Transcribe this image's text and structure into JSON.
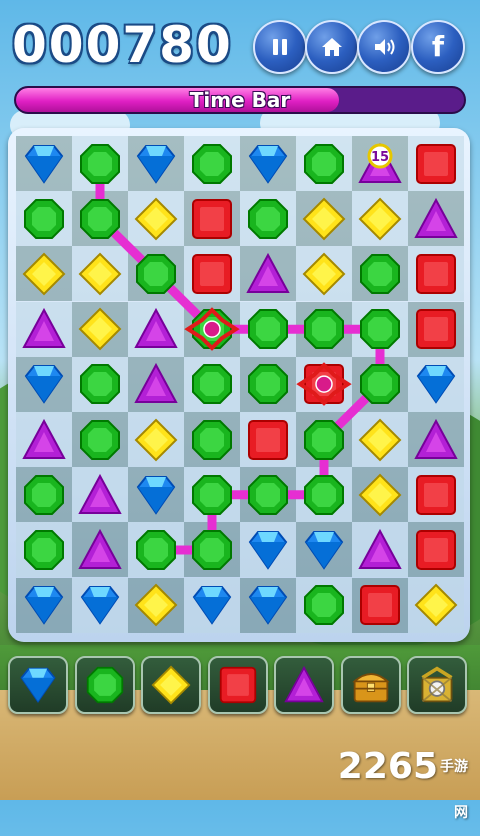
{
  "header": {
    "score": "000780",
    "buttons": [
      {
        "name": "pause-button",
        "icon": "pause-icon"
      },
      {
        "name": "home-button",
        "icon": "home-icon"
      },
      {
        "name": "sound-button",
        "icon": "speaker-icon"
      },
      {
        "name": "facebook-button",
        "icon": "facebook-icon",
        "label": "f"
      }
    ]
  },
  "timebar": {
    "label": "Time Bar",
    "fill_fraction": 0.72
  },
  "board": {
    "rows": 9,
    "cols": 8,
    "grid": [
      [
        "blue",
        "green",
        "blue",
        "green",
        "blue",
        "green",
        "timer",
        "red"
      ],
      [
        "green",
        "green",
        "yellow",
        "red",
        "green",
        "yellow",
        "yellow",
        "purple"
      ],
      [
        "yellow",
        "yellow",
        "green",
        "red",
        "purple",
        "yellow",
        "green",
        "red"
      ],
      [
        "purple",
        "yellow",
        "purple",
        "green",
        "green",
        "green",
        "green",
        "red"
      ],
      [
        "blue",
        "green",
        "purple",
        "green",
        "green",
        "red",
        "green",
        "blue"
      ],
      [
        "purple",
        "green",
        "yellow",
        "green",
        "red",
        "green",
        "yellow",
        "purple"
      ],
      [
        "green",
        "purple",
        "blue",
        "green",
        "green",
        "green",
        "yellow",
        "red"
      ],
      [
        "green",
        "purple",
        "green",
        "green",
        "blue",
        "blue",
        "purple",
        "red"
      ],
      [
        "blue",
        "blue",
        "yellow",
        "blue",
        "blue",
        "green",
        "red",
        "yellow"
      ]
    ],
    "timer_gem": {
      "color": "purple",
      "value": "15"
    },
    "special_marks": [
      {
        "row": 3,
        "col": 3,
        "type": "red-burst-icon"
      },
      {
        "row": 4,
        "col": 5,
        "type": "red-burst-icon"
      }
    ],
    "path": [
      [
        0,
        1
      ],
      [
        1,
        1
      ],
      [
        2,
        2
      ],
      [
        3,
        3
      ],
      [
        3,
        4
      ],
      [
        3,
        5
      ],
      [
        3,
        6
      ],
      [
        4,
        6
      ],
      [
        5,
        5
      ],
      [
        6,
        5
      ],
      [
        6,
        4
      ],
      [
        6,
        3
      ],
      [
        7,
        3
      ],
      [
        7,
        2
      ]
    ],
    "path_color": "#e62ed2"
  },
  "tray": {
    "slots": [
      "blue",
      "green",
      "yellow",
      "red",
      "purple",
      "treasure-chest-icon",
      "locked-crate-icon"
    ]
  },
  "colors": {
    "blue": "#1e88f0",
    "green": "#19b51e",
    "yellow": "#ffe31a",
    "red": "#e81c24",
    "purple": "#b320d6"
  },
  "watermark": {
    "number": "2265",
    "suffix": "手游网"
  }
}
